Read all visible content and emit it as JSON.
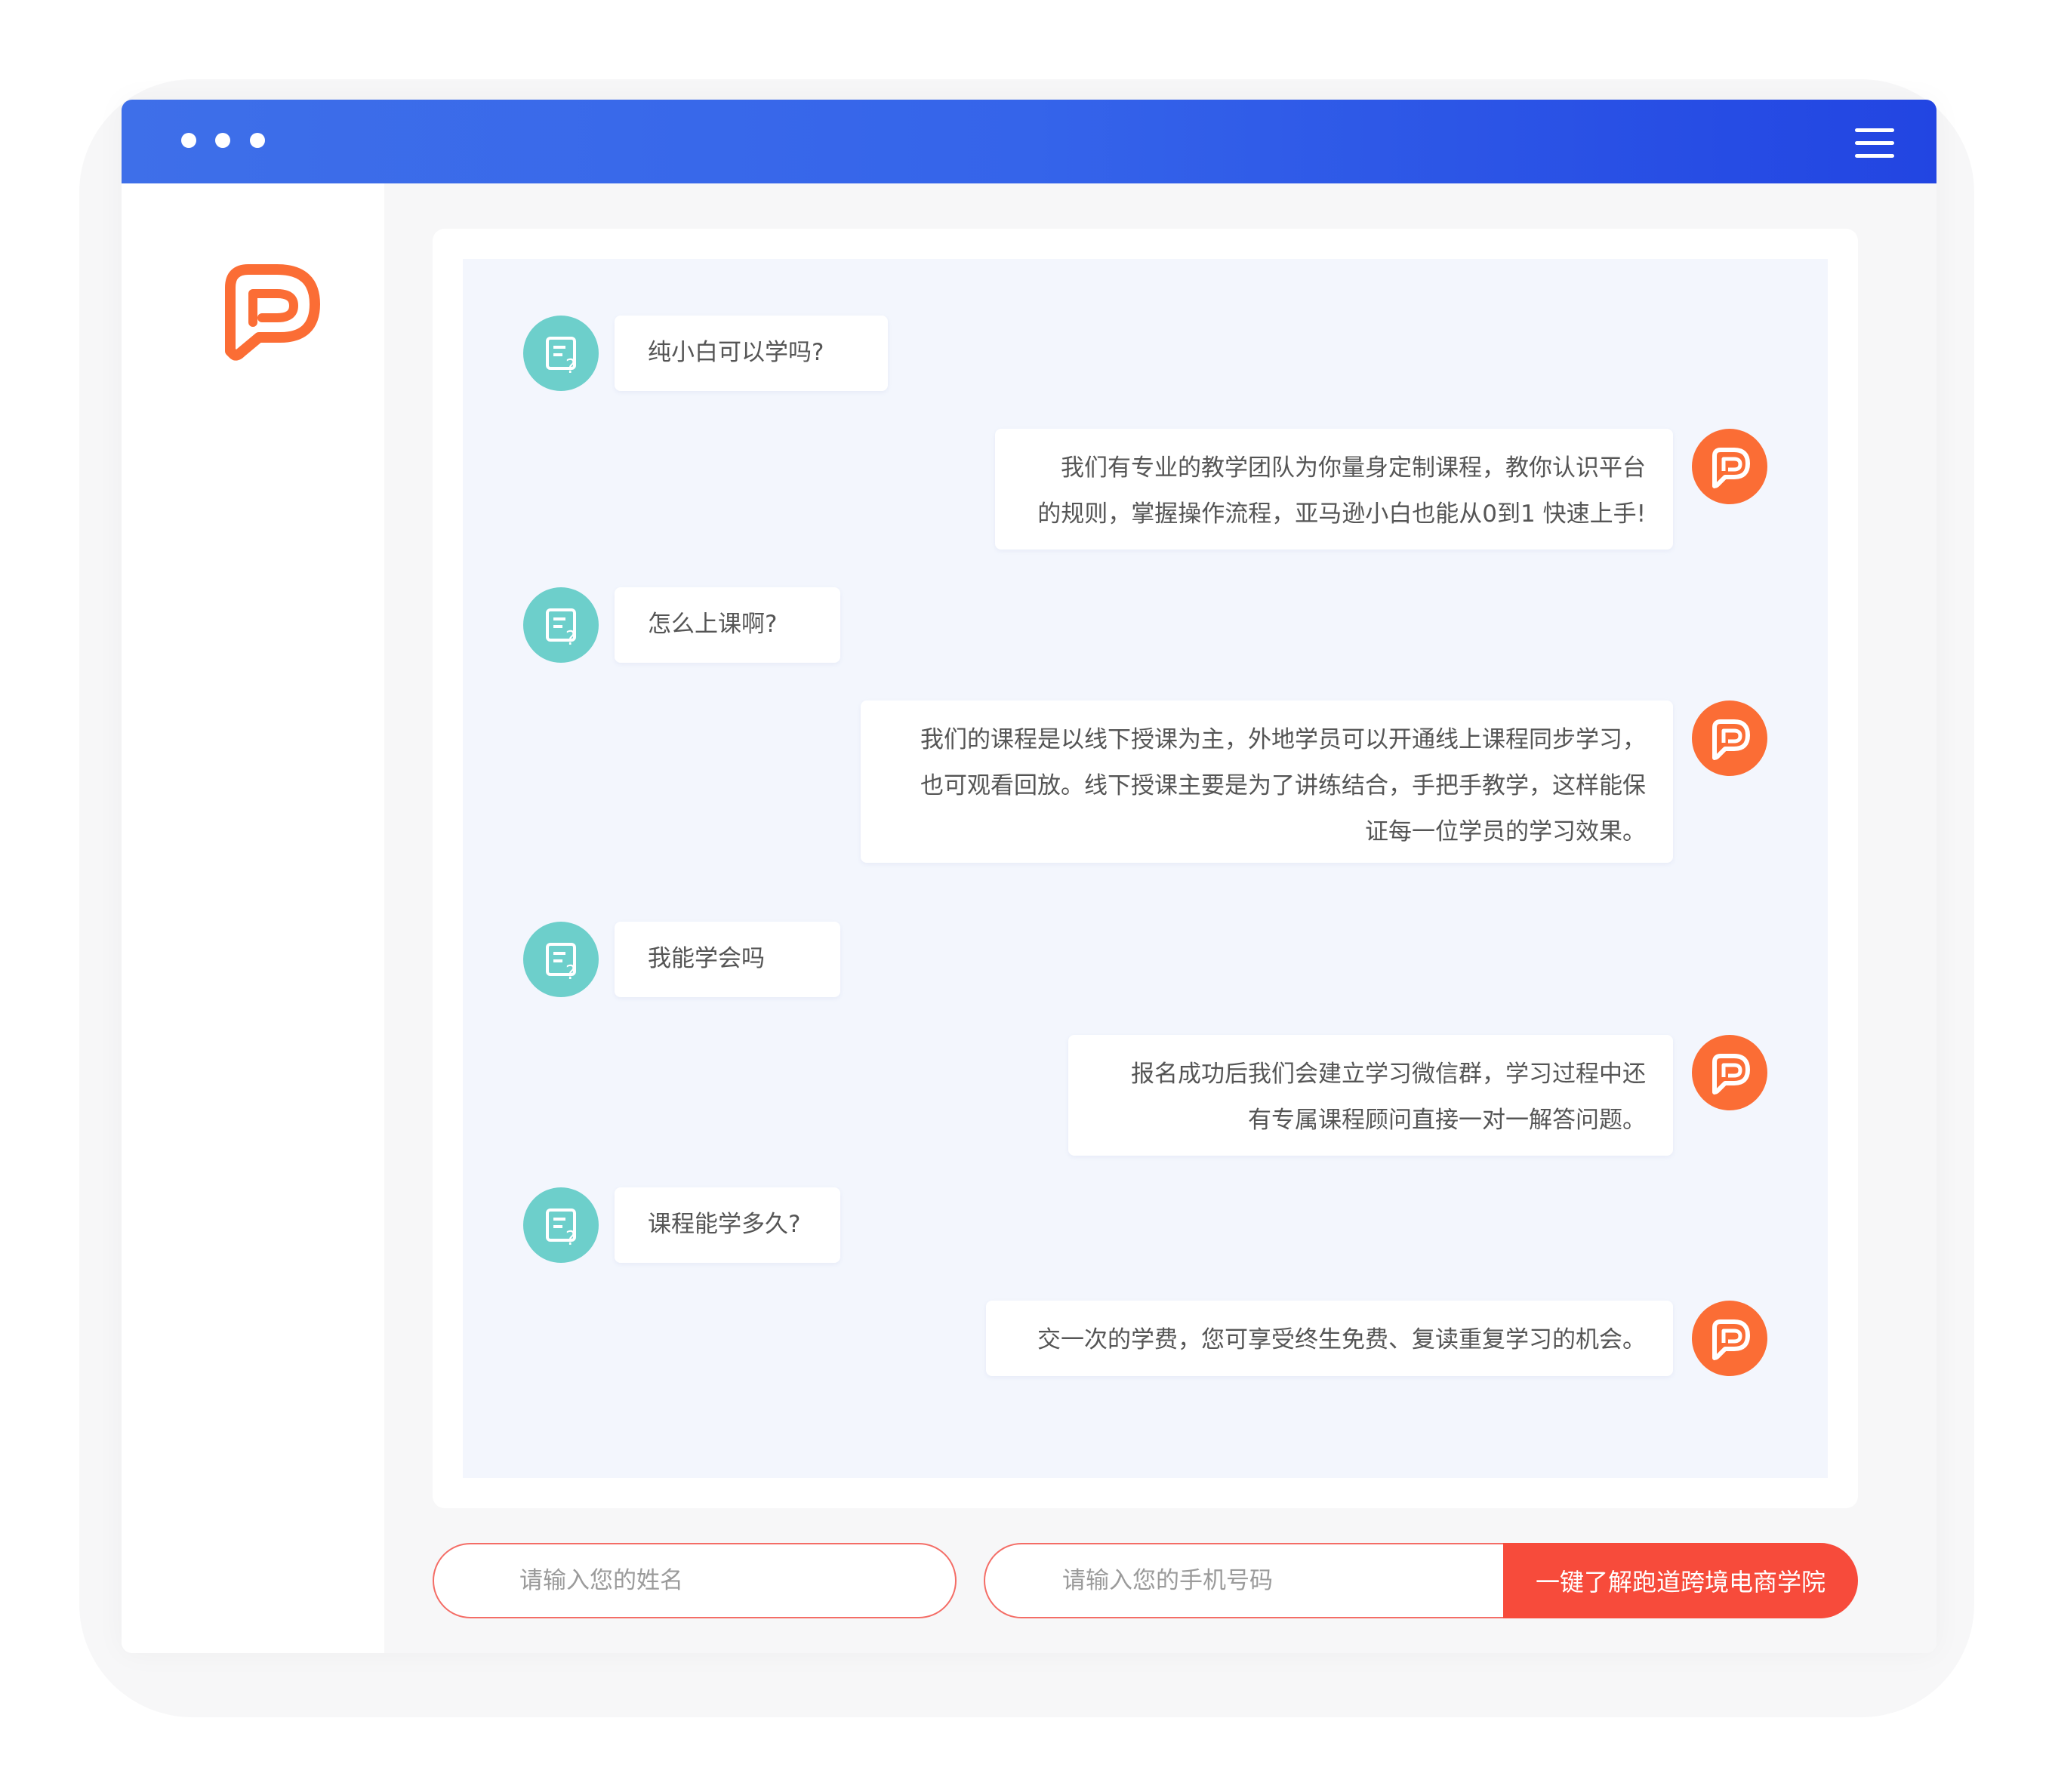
{
  "window": {
    "titlebar_gradient": [
      "#3e6fe9",
      "#2245e2"
    ],
    "dot_icons": [
      "dot-icon",
      "dot-icon",
      "dot-icon"
    ],
    "menu_icon": "hamburger-menu-icon"
  },
  "sidebar": {
    "logo_icon": "paodao-brand-logo",
    "logo_color": "#fb6d35"
  },
  "chat": {
    "user_avatar_icon": "question-note-icon",
    "user_avatar_color": "#6dcfcb",
    "bot_avatar_icon": "paodao-logo-icon",
    "bot_avatar_color": "#fb6d35",
    "messages": [
      {
        "role": "user",
        "text": "纯小白可以学吗?"
      },
      {
        "role": "bot",
        "lines": [
          "我们有专业的教学团队为你量身定制课程，教你认识平台",
          "的规则，掌握操作流程，亚马逊小白也能从0到1 快速上手!"
        ]
      },
      {
        "role": "user",
        "text": "怎么上课啊?"
      },
      {
        "role": "bot",
        "lines": [
          "我们的课程是以线下授课为主，外地学员可以开通线上课程同步学习，",
          "也可观看回放。线下授课主要是为了讲练结合，手把手教学，这样能保",
          "证每一位学员的学习效果。"
        ]
      },
      {
        "role": "user",
        "text": "我能学会吗"
      },
      {
        "role": "bot",
        "lines": [
          "报名成功后我们会建立学习微信群，学习过程中还",
          "有专属课程顾问直接一对一解答问题。"
        ]
      },
      {
        "role": "user",
        "text": "课程能学多久?"
      },
      {
        "role": "bot",
        "lines": [
          "交一次的学费，您可享受终生免费、复读重复学习的机会。"
        ]
      }
    ]
  },
  "form": {
    "name_placeholder": "请输入您的姓名",
    "phone_placeholder": "请输入您的手机号码",
    "submit_label": "一键了解跑道跨境电商学院",
    "accent_color": "#f74b3b"
  }
}
